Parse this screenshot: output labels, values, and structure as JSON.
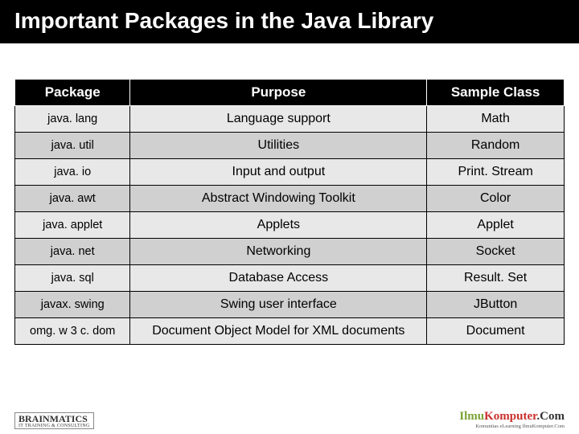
{
  "title": "Important Packages in the Java Library",
  "table": {
    "headers": [
      "Package",
      "Purpose",
      "Sample Class"
    ],
    "rows": [
      {
        "package": "java. lang",
        "purpose": "Language support",
        "sample": "Math"
      },
      {
        "package": "java. util",
        "purpose": "Utilities",
        "sample": "Random"
      },
      {
        "package": "java. io",
        "purpose": "Input and output",
        "sample": "Print. Stream"
      },
      {
        "package": "java. awt",
        "purpose": "Abstract Windowing Toolkit",
        "sample": "Color"
      },
      {
        "package": "java. applet",
        "purpose": "Applets",
        "sample": "Applet"
      },
      {
        "package": "java. net",
        "purpose": "Networking",
        "sample": "Socket"
      },
      {
        "package": "java. sql",
        "purpose": "Database Access",
        "sample": "Result. Set"
      },
      {
        "package": "javax. swing",
        "purpose": "Swing user interface",
        "sample": "JButton"
      },
      {
        "package": "omg. w 3 c. dom",
        "purpose": "Document Object Model for XML documents",
        "sample": "Document"
      }
    ]
  },
  "footer": {
    "left_brand": "BRAINMATICS",
    "left_sub": "IT TRAINING & CONSULTING",
    "right_ilmu": "Ilmu",
    "right_komputer": "Komputer",
    "right_com": ".Com",
    "right_sub": "Komunitas eLearning IlmuKomputer.Com"
  }
}
